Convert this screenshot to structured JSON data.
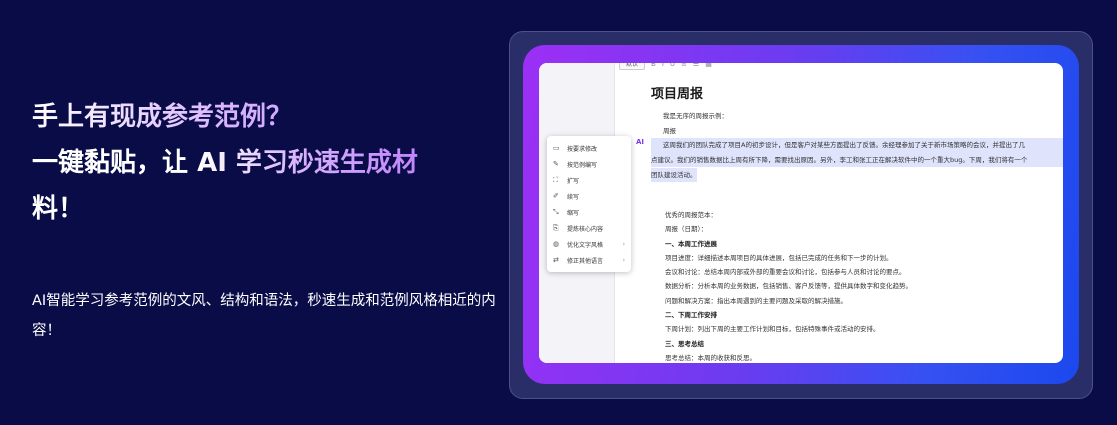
{
  "hero": {
    "heading_line1": "手上有现成参考范例？",
    "heading_line2_a": "一键黏贴，让",
    "heading_line2_b": "AI 学习秒速生成材",
    "heading_line3": "料！",
    "description": "AI智能学习参考范例的文风、结构和语法，秒速生成和范例风格相近的内容！"
  },
  "editor": {
    "toolbar_button": "默认",
    "doc_title": "项目周报",
    "ai_marker": "AI",
    "upper_lines": [
      "我是无序的周报示例：",
      "周报",
      "这周我们的团队完成了项目A的初步设计，但是客户对某些方面提出了反馈。余经理参加了关于新市场策略的会议，并提出了几",
      "点建议。我们的销售数据比上周有所下降，需要找出原因。另外，李工和张工正在解决软件中的一个重大bug。下周，我们将有一个",
      "团队建设活动。"
    ],
    "lower_lines": [
      "优秀的周报范本：",
      "周报（日期）：",
      "一、本周工作进展",
      "项目进度：详细描述本周项目的具体进展，包括已完成的任务和下一步的计划。",
      "会议和讨论：总结本周内部或外部的重要会议和讨论，包括参与人员和讨论的要点。",
      "数据分析：分析本周的业务数据，包括销售、客户反馈等，提供具体数字和变化趋势。",
      "问题和解决方案：指出本周遇到的主要问题及采取的解决措施。",
      "二、下周工作安排",
      "下周计划：列出下周的主要工作计划和目标，包括特殊事件或活动的安排。",
      "三、思考总结",
      "思考总结：本周的收获和反思。"
    ],
    "ai_menu": [
      {
        "icon": "▭",
        "label": "按要求修改",
        "arrow": ""
      },
      {
        "icon": "✎",
        "label": "按范例编写",
        "arrow": ""
      },
      {
        "icon": "⛶",
        "label": "扩写",
        "arrow": ""
      },
      {
        "icon": "✐",
        "label": "续写",
        "arrow": ""
      },
      {
        "icon": "⤡",
        "label": "缩写",
        "arrow": ""
      },
      {
        "icon": "⎘",
        "label": "提炼核心内容",
        "arrow": ""
      },
      {
        "icon": "◍",
        "label": "优化文字风格",
        "arrow": "›"
      },
      {
        "icon": "⇄",
        "label": "修正其他语言",
        "arrow": "›"
      }
    ]
  },
  "colors": {
    "page_bg": "#0a0c48",
    "accent_purple": "#9d2ff5",
    "accent_blue": "#1b48ee",
    "highlight": "#dfe3fb"
  }
}
